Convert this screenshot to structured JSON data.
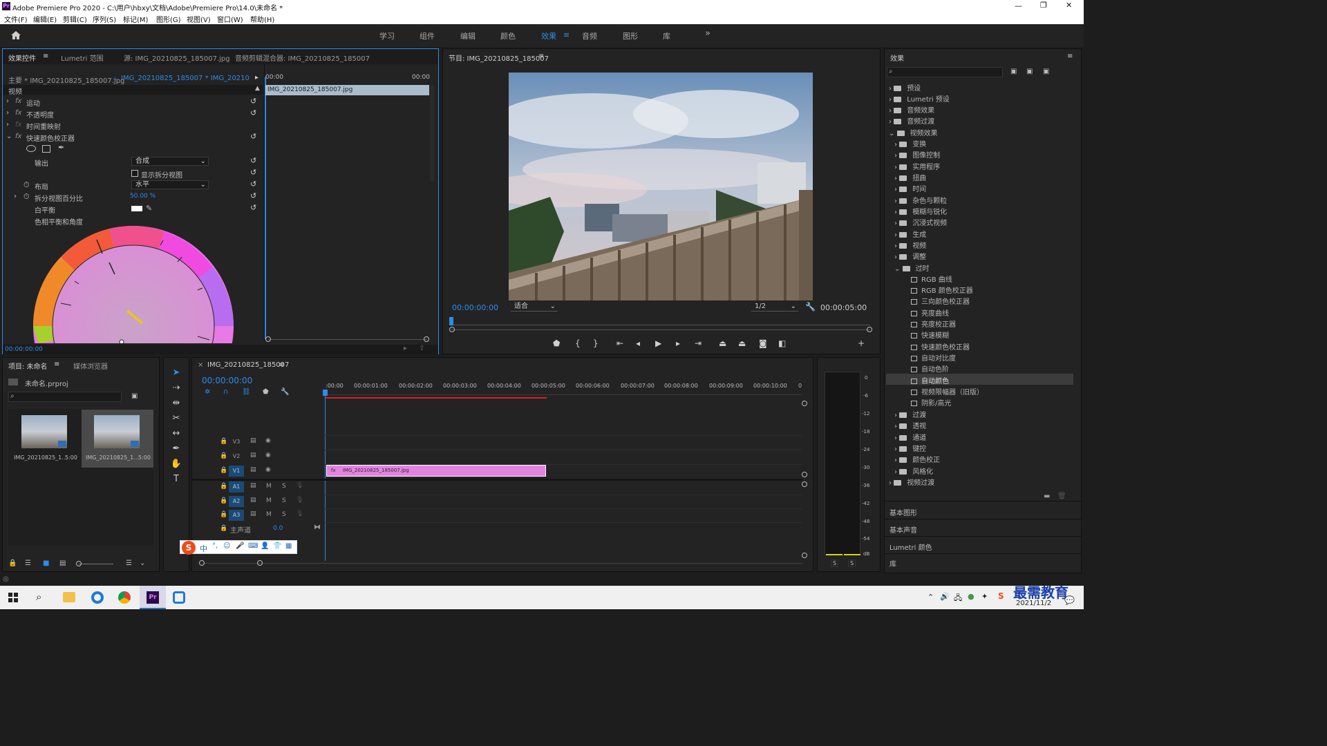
{
  "app": {
    "title": "Adobe Premiere Pro 2020 - C:\\用户\\hbxy\\文档\\Adobe\\Premiere Pro\\14.0\\未命名 *",
    "icon": "Pr"
  },
  "window_controls": {
    "minimize": "—",
    "maximize": "❐",
    "close": "✕"
  },
  "menu": [
    "文件(F)",
    "编辑(E)",
    "剪辑(C)",
    "序列(S)",
    "标记(M)",
    "图形(G)",
    "视图(V)",
    "窗口(W)",
    "帮助(H)"
  ],
  "workspaces": {
    "items": [
      "学习",
      "组件",
      "编辑",
      "颜色",
      "效果",
      "音频",
      "图形",
      "库"
    ],
    "active": "效果",
    "more": "»"
  },
  "effect_controls": {
    "tabs": [
      "效果控件",
      "Lumetri 范围",
      "源: IMG_20210825_185007.jpg",
      "音频剪辑混合器: IMG_20210825_185007"
    ],
    "master": "主要 * IMG_20210825_185007.jpg",
    "sequence_clip": "IMG_20210825_185007 * IMG_20210825_...",
    "mini_timeline": {
      "start": "00:00",
      "end": "00:00",
      "clip": "IMG_20210825_185007.jpg"
    },
    "section": "视频",
    "rows": [
      {
        "fx": "fx",
        "label": "运动"
      },
      {
        "fx": "fx",
        "label": "不透明度"
      },
      {
        "fx": "fx",
        "label": "时间重映射"
      },
      {
        "fx": "fx",
        "label": "快速颜色校正器"
      }
    ],
    "output_label": "输出",
    "output_value": "合成",
    "split_view_label": "显示拆分视图",
    "layout_label": "布局",
    "layout_value": "水平",
    "split_pct_label": "拆分视图百分比",
    "split_pct_value": "50.00 %",
    "white_balance_label": "白平衡",
    "hue_balance_label": "色相平衡和角度",
    "timecode": "00:00:00:00"
  },
  "program_monitor": {
    "title": "节目: IMG_20210825_185007",
    "timecode_in": "00:00:00:00",
    "fit": "适合",
    "resolution": "1/2",
    "duration": "00:00:05:00"
  },
  "effects_panel": {
    "title": "效果",
    "search_placeholder": "",
    "top_items": [
      "预设",
      "Lumetri 预设",
      "音频效果",
      "音频过渡",
      "视频效果"
    ],
    "video_effects": [
      "变换",
      "图像控制",
      "实用程序",
      "扭曲",
      "时间",
      "杂色与颗粒",
      "模糊与锐化",
      "沉浸式视频",
      "生成",
      "视频",
      "调整",
      "过时"
    ],
    "obsolete_items": [
      "RGB 曲线",
      "RGB 颜色校正器",
      "三向颜色校正器",
      "亮度曲线",
      "亮度校正器",
      "快速模糊",
      "快速颜色校正器",
      "自动对比度",
      "自动色阶",
      "自动颜色",
      "视频限幅器（旧版）",
      "阴影/高光"
    ],
    "selected": "自动颜色",
    "after_items": [
      "过渡",
      "透视",
      "通道",
      "键控",
      "颜色校正",
      "风格化"
    ],
    "video_transitions": "视频过渡",
    "bottom_panels": [
      "基本图形",
      "基本声音",
      "Lumetri 颜色",
      "库"
    ]
  },
  "project_panel": {
    "tabs": [
      "项目: 未命名",
      "媒体浏览器"
    ],
    "file": "未命名.prproj",
    "items": [
      {
        "name": "IMG_20210825_1...",
        "duration": "5:00"
      },
      {
        "name": "IMG_20210825_1...",
        "duration": "5:00"
      }
    ]
  },
  "timeline": {
    "tab": "IMG_20210825_185007",
    "timecode": "00:00:00:00",
    "ruler": [
      ":00:00",
      "00:00:01:00",
      "00:00:02:00",
      "00:00:03:00",
      "00:00:04:00",
      "00:00:05:00",
      "00:00:06:00",
      "00:00:07:00",
      "00:00:08:00",
      "00:00:09:00",
      "00:00:10:00",
      "0"
    ],
    "video_tracks": [
      "V3",
      "V2",
      "V1"
    ],
    "audio_tracks": [
      "A1",
      "A2",
      "A3"
    ],
    "master_label": "主声道",
    "master_value": "0.0",
    "clip": "IMG_20210825_185007.jpg",
    "m": "M",
    "s": "S"
  },
  "audio_meter": {
    "scale": [
      "0",
      "-6",
      "-12",
      "-18",
      "-24",
      "-30",
      "-36",
      "-42",
      "-48",
      "-54",
      "dB"
    ],
    "solo": [
      "S",
      "S"
    ]
  },
  "ime_toolbar": {
    "logo": "S",
    "lang": "中"
  },
  "taskbar": {
    "date": "2021/11/2",
    "watermark": "最需教育"
  },
  "colors": {
    "accent": "#2d8ceb",
    "clip": "#e184e0",
    "playhead": "#2d8ceb",
    "timeline_red": "#e02020"
  }
}
